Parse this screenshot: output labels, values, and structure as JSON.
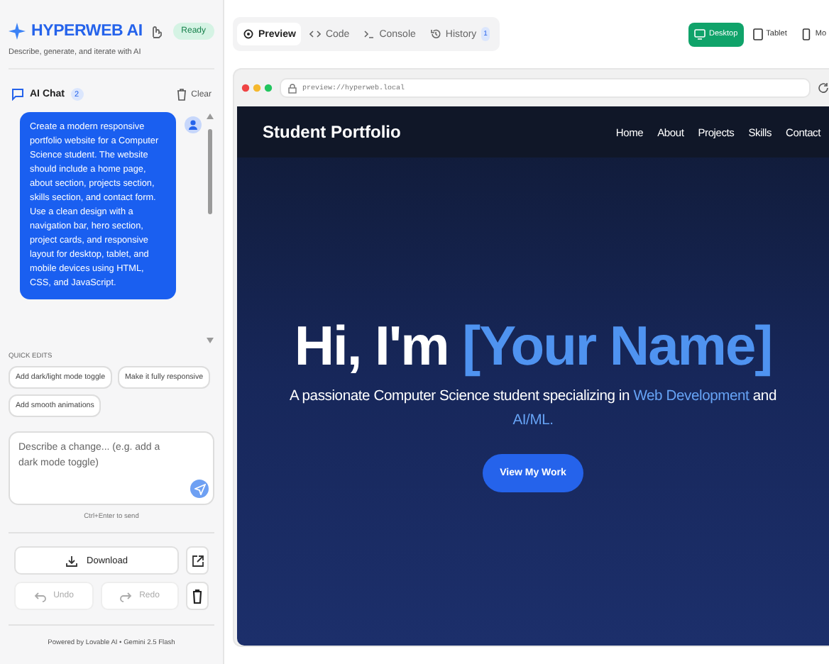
{
  "sidebar": {
    "brand": "HYPERWEB AI",
    "status": "Ready",
    "tagline": "Describe, generate, and iterate with AI",
    "chat": {
      "title": "AI Chat",
      "count": "2",
      "clear": "Clear",
      "messages": [
        {
          "text": "Create a modern responsive portfolio website for a Computer Science student. The website should include a home page, about section, projects section, skills section, and contact form. Use a clean design with a navigation bar, hero section, project cards, and responsive layout for desktop, tablet, and mobile devices using HTML, CSS, and JavaScript."
        }
      ]
    },
    "quick_edits": {
      "label": "QUICK EDITS",
      "items": [
        "Add dark/light mode toggle",
        "Make it fully responsive",
        "Add smooth animations"
      ]
    },
    "composer": {
      "placeholder": "Describe a change... (e.g. add a dark mode toggle)",
      "hint": "Ctrl+Enter to send"
    },
    "download": "Download",
    "undo": {
      "label": "Undo",
      "disabled": true
    },
    "redo": {
      "label": "Redo",
      "disabled": true
    },
    "footer": "Powered by Lovable AI • Gemini 2.5 Flash"
  },
  "tabs": [
    {
      "label": "Preview",
      "selected": true
    },
    {
      "label": "Code",
      "selected": false
    },
    {
      "label": "Console",
      "selected": false
    },
    {
      "label": "History",
      "selected": false,
      "badge": "1"
    }
  ],
  "devices": [
    {
      "label": "Desktop",
      "kind": "desktop",
      "selected": true
    },
    {
      "label": "Tablet",
      "kind": "tablet",
      "selected": false
    },
    {
      "label": "Mo",
      "kind": "mobile",
      "selected": false
    }
  ],
  "browser": {
    "url": "preview://hyperweb.local"
  },
  "site": {
    "brand": "Student Portfolio",
    "nav": [
      "Home",
      "About",
      "Projects",
      "Skills",
      "Contact"
    ],
    "hero": {
      "greeting": "Hi, I'm ",
      "name": "[Your Name]",
      "subtitle": [
        {
          "text": "A passionate Computer Science student specializing in ",
          "highlight": false
        },
        {
          "text": "Web Development",
          "highlight": true
        },
        {
          "text": " and ",
          "highlight": false
        },
        {
          "text": "AI/ML.",
          "highlight": true
        }
      ],
      "button": "View My Work"
    }
  }
}
